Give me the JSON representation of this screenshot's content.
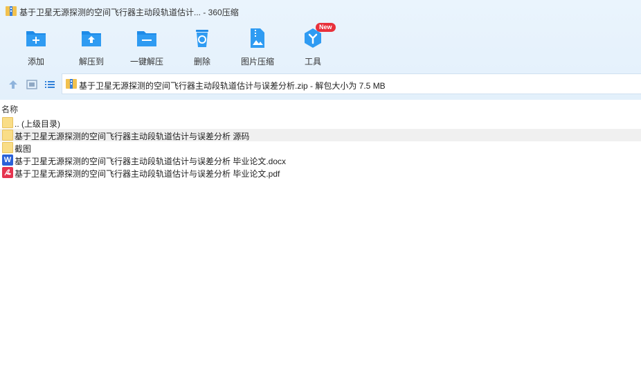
{
  "window": {
    "title": "基于卫星无源探测的空间飞行器主动段轨道估计... - 360压缩"
  },
  "toolbar": {
    "items": [
      {
        "label": "添加",
        "icon": "add-folder-icon"
      },
      {
        "label": "解压到",
        "icon": "extract-to-icon"
      },
      {
        "label": "一键解压",
        "icon": "one-click-extract-icon"
      },
      {
        "label": "删除",
        "icon": "recycle-bin-icon"
      },
      {
        "label": "图片压缩",
        "icon": "image-compress-icon"
      },
      {
        "label": "工具",
        "icon": "tools-icon",
        "badge": "New"
      }
    ]
  },
  "colors": {
    "accent": "#1e8be8",
    "badge": "#e8313b",
    "folder": "#f9dd87"
  },
  "address": {
    "path_text": "基于卫星无源探测的空间飞行器主动段轨道估计与误差分析.zip - 解包大小为 7.5 MB"
  },
  "list": {
    "column_name": "名称",
    "rows": [
      {
        "name": ".. (上级目录)",
        "type": "folder",
        "highlight": false
      },
      {
        "name": "基于卫星无源探测的空间飞行器主动段轨道估计与误差分析 源码",
        "type": "folder",
        "highlight": true
      },
      {
        "name": "截图",
        "type": "folder",
        "highlight": false
      },
      {
        "name": "基于卫星无源探测的空间飞行器主动段轨道估计与误差分析 毕业论文.docx",
        "type": "docx",
        "highlight": false
      },
      {
        "name": "基于卫星无源探测的空间飞行器主动段轨道估计与误差分析 毕业论文.pdf",
        "type": "pdf",
        "highlight": false
      }
    ]
  }
}
